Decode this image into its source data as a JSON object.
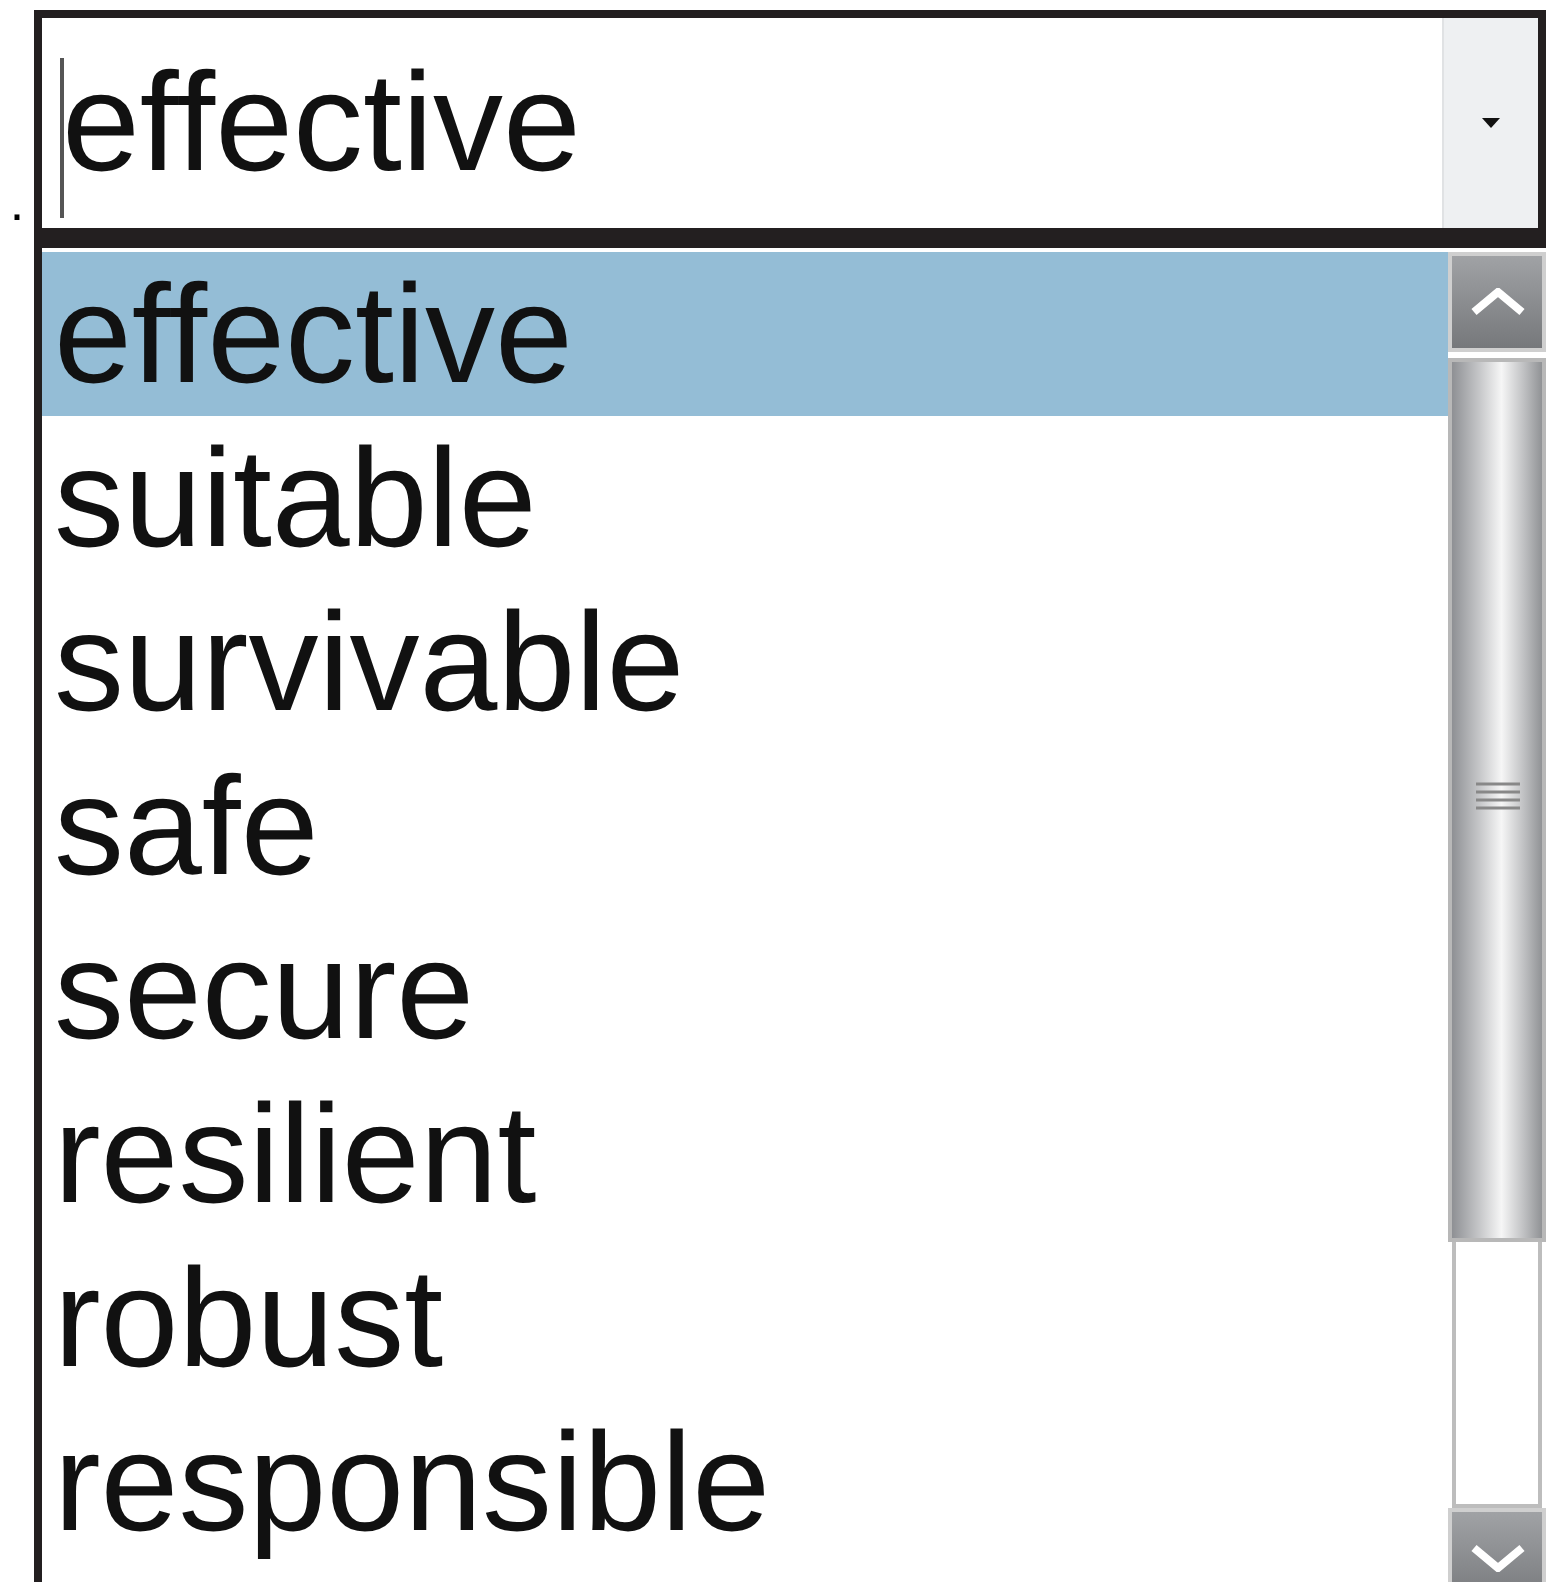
{
  "leading_text": ".",
  "combo": {
    "value": "effective",
    "focused": true
  },
  "options": [
    {
      "label": "effective",
      "selected": true
    },
    {
      "label": "suitable",
      "selected": false
    },
    {
      "label": "survivable",
      "selected": false
    },
    {
      "label": "safe",
      "selected": false
    },
    {
      "label": "secure",
      "selected": false
    },
    {
      "label": "resilient",
      "selected": false
    },
    {
      "label": "robust",
      "selected": false
    },
    {
      "label": "responsible",
      "selected": false
    }
  ]
}
